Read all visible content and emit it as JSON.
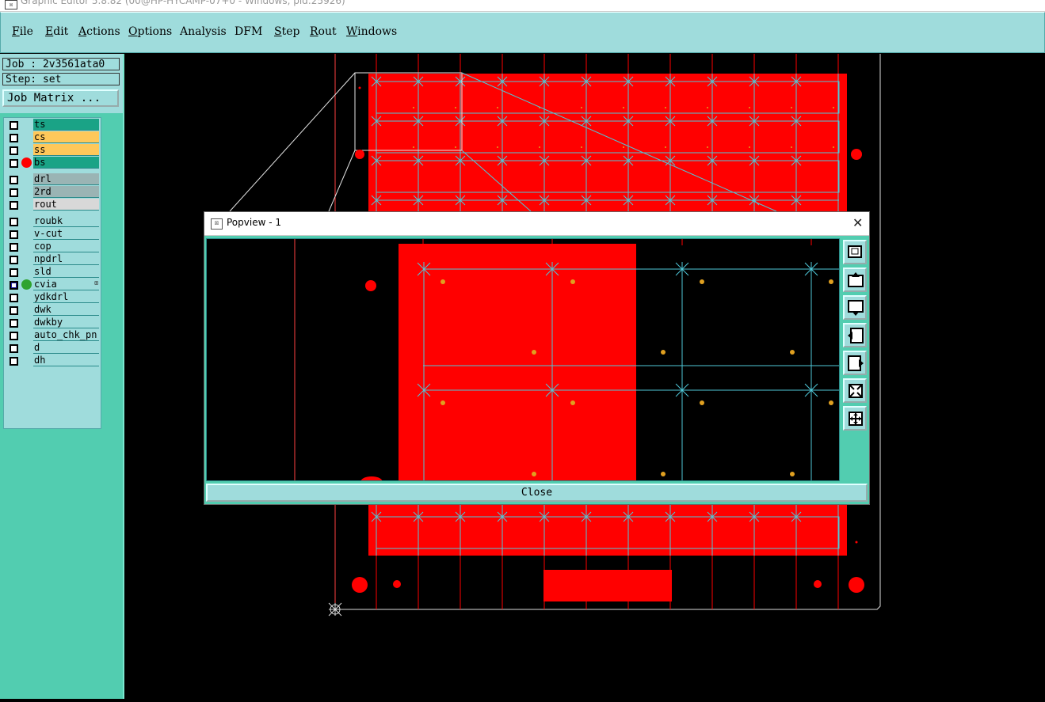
{
  "window": {
    "title": "Graphic Editor 5.8.82 (00@HP-HYCAMP-07+0 - Windows, pid:25926)"
  },
  "menu": [
    {
      "u": "F",
      "rest": "ile"
    },
    {
      "u": "E",
      "rest": "dit"
    },
    {
      "u": "A",
      "rest": "ctions"
    },
    {
      "u": "O",
      "rest": "ptions"
    },
    {
      "u": "",
      "rest": "Analysis"
    },
    {
      "u": "",
      "rest": "DFM"
    },
    {
      "u": "S",
      "rest": "tep"
    },
    {
      "u": "R",
      "rest": "out"
    },
    {
      "u": "W",
      "rest": "indows"
    }
  ],
  "side": {
    "job": "Job : 2v3561ata0",
    "step": "Step: set",
    "job_matrix": "Job Matrix ..."
  },
  "layers": [
    {
      "name": "ts",
      "color": "#1aa386"
    },
    {
      "name": "cs",
      "color": "#ffc85a"
    },
    {
      "name": "ss",
      "color": "#ffc85a"
    },
    {
      "name": "bs",
      "color": "#1aa386",
      "dot": "red"
    },
    {
      "name": "drl",
      "color": "#9ab4b4"
    },
    {
      "name": "2rd",
      "color": "#9ab4b4"
    },
    {
      "name": "rout",
      "color": "#d8d8d8"
    },
    {
      "name": "roubk",
      "color": "#9fdcdc"
    },
    {
      "name": "v-cut",
      "color": "#9fdcdc"
    },
    {
      "name": "cop",
      "color": "#9fdcdc"
    },
    {
      "name": "npdrl",
      "color": "#9fdcdc"
    },
    {
      "name": "sld",
      "color": "#9fdcdc"
    },
    {
      "name": "cvia",
      "color": "#9fdcdc",
      "dot": "green",
      "selected": true,
      "flag": "⊞"
    },
    {
      "name": "ydkdrl",
      "color": "#9fdcdc"
    },
    {
      "name": "dwk",
      "color": "#9fdcdc"
    },
    {
      "name": "dwkby",
      "color": "#9fdcdc"
    },
    {
      "name": "auto_chk_pn",
      "color": "#9fdcdc"
    },
    {
      "name": "d",
      "color": "#9fdcdc"
    },
    {
      "name": "dh",
      "color": "#9fdcdc"
    }
  ],
  "popup": {
    "title": "Popview - 1",
    "close_x": "✕",
    "close_label": "Close",
    "tools": [
      "zoom-window-icon",
      "pan-up-icon",
      "pan-down-icon",
      "pan-left-icon",
      "pan-right-icon",
      "zoom-out-icon",
      "zoom-in-icon"
    ]
  },
  "colors": {
    "panel": "#9fdcdc",
    "side": "#52cdb0",
    "board": "#ff0000",
    "grid": "#4fc8d8",
    "pad": "#e0a020"
  }
}
